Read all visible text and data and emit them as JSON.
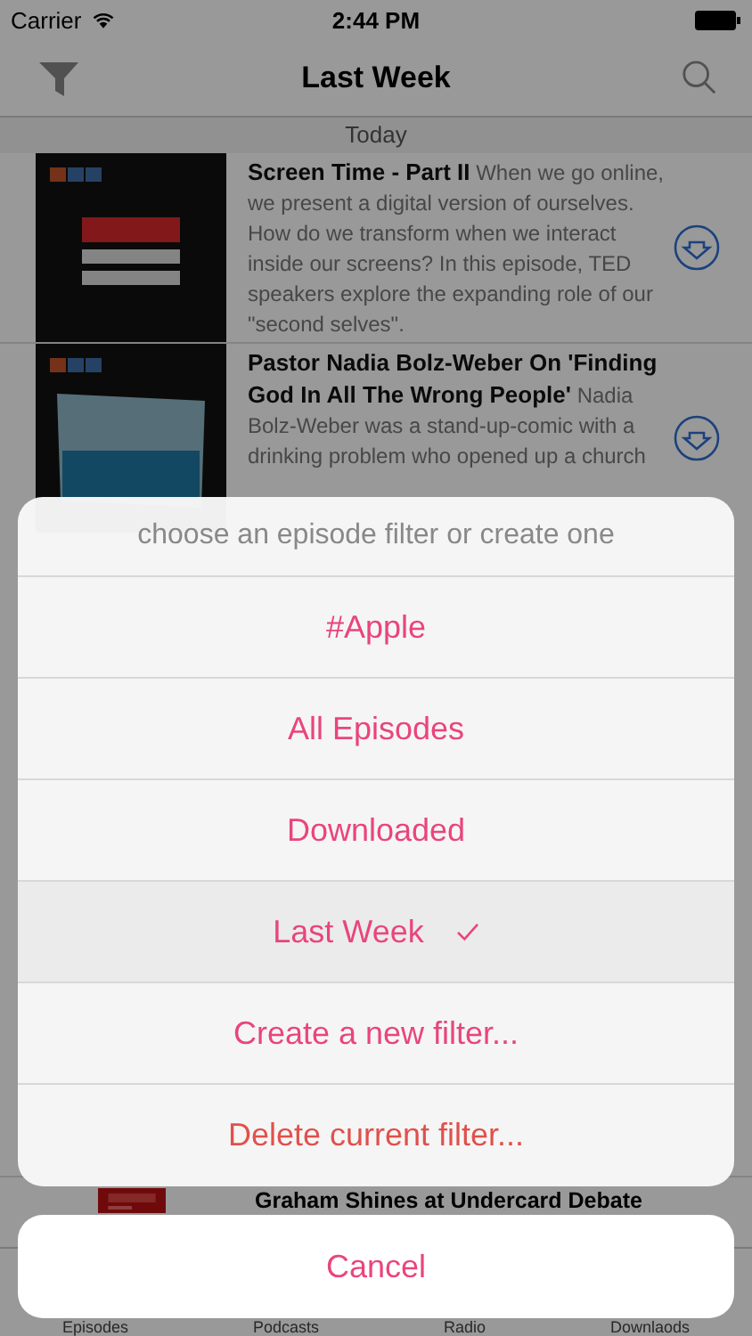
{
  "status_bar": {
    "carrier": "Carrier",
    "time": "2:44 PM"
  },
  "nav": {
    "title": "Last Week"
  },
  "section": {
    "title": "Today"
  },
  "episodes": [
    {
      "title": "Screen Time - Part II",
      "description": "When we go online, we present a digital version of ourselves. How do we transform when we interact inside our screens? In this episode, TED speakers explore the expanding role of our \"second selves\"."
    },
    {
      "title": "Pastor Nadia Bolz-Weber On 'Finding God In All The Wrong People'",
      "description": "Nadia Bolz-Weber was a stand-up-comic with a drinking problem who opened up a church"
    }
  ],
  "partial_episode": {
    "title": "Graham Shines at Undercard Debate"
  },
  "tab_bar": [
    {
      "label": "Episodes"
    },
    {
      "label": "Podcasts"
    },
    {
      "label": "Radio"
    },
    {
      "label": "Downlaods"
    }
  ],
  "action_sheet": {
    "title": "choose an episode filter or create one",
    "options": [
      {
        "label": "#Apple",
        "kind": "filter",
        "selected": false
      },
      {
        "label": "All Episodes",
        "kind": "filter",
        "selected": false
      },
      {
        "label": "Downloaded",
        "kind": "filter",
        "selected": false
      },
      {
        "label": "Last Week",
        "kind": "filter",
        "selected": true
      },
      {
        "label": "Create a new filter...",
        "kind": "action",
        "selected": false
      },
      {
        "label": "Delete current filter...",
        "kind": "destructive",
        "selected": false
      }
    ],
    "cancel": "Cancel"
  }
}
